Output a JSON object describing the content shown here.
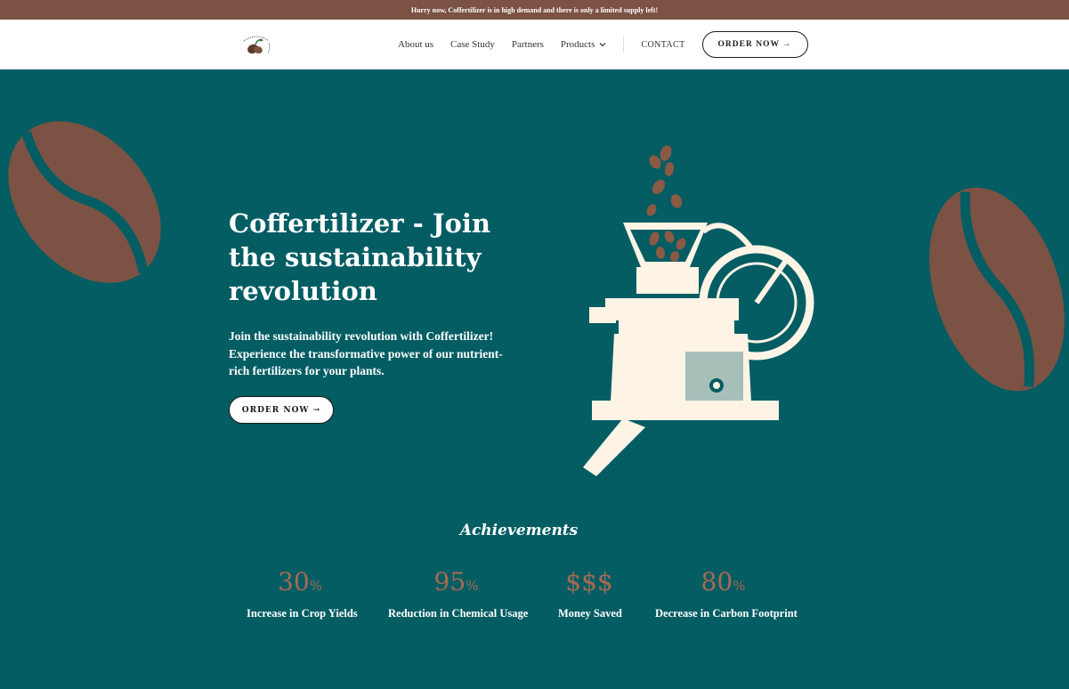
{
  "promo": {
    "text": "Hurry now, Coffertilizer is in high demand and there is only a limited supply left!"
  },
  "nav": {
    "items": [
      "About us",
      "Case Study",
      "Partners",
      "Products"
    ],
    "contact": "CONTACT",
    "order_label": "ORDER NOW →"
  },
  "hero": {
    "title": "Coffertilizer - Join the sustainability revolution",
    "description": "Join the sustainability revolution with Coffertilizer! Experience the transformative power of our nutrient-rich fertilizers for your plants.",
    "order_label": "ORDER NOW →"
  },
  "achievements": {
    "title": "Achievements",
    "stats": [
      {
        "value": "30",
        "unit": "%",
        "label": "Increase in Crop Yields"
      },
      {
        "value": "95",
        "unit": "%",
        "label": "Reduction in Chemical Usage"
      },
      {
        "value": "$$$",
        "unit": "",
        "label": "Money Saved"
      },
      {
        "value": "80",
        "unit": "%",
        "label": "Decrease in Carbon Footprint"
      }
    ]
  },
  "colors": {
    "promo_bg": "#7b5244",
    "hero_bg": "#035d63",
    "bean": "#7b5244",
    "stat_value": "#a86a52",
    "grinder": "#fdf4e6"
  }
}
